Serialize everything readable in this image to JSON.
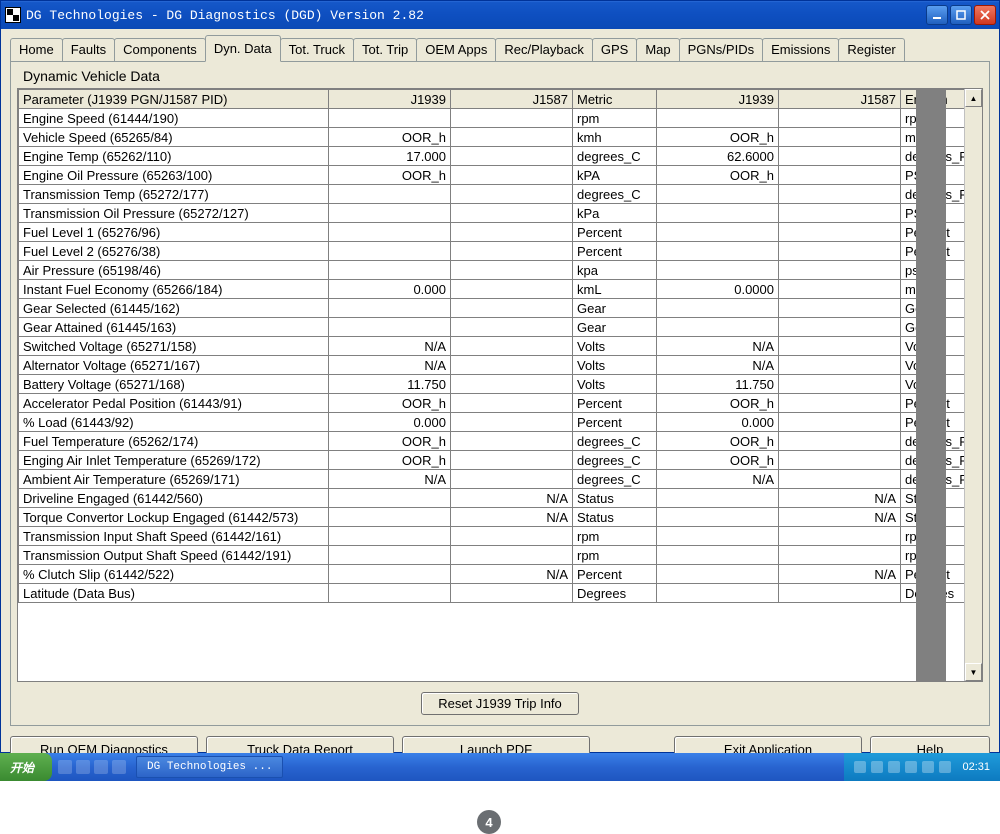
{
  "window": {
    "title": "DG Technologies - DG Diagnostics (DGD) Version 2.82"
  },
  "tabs": [
    "Home",
    "Faults",
    "Components",
    "Dyn. Data",
    "Tot. Truck",
    "Tot. Trip",
    "OEM Apps",
    "Rec/Playback",
    "GPS",
    "Map",
    "PGNs/PIDs",
    "Emissions",
    "Register"
  ],
  "active_tab": "Dyn. Data",
  "panel_title": "Dynamic Vehicle Data",
  "grid": {
    "headers": [
      "Parameter (J1939 PGN/J1587 PID)",
      "J1939",
      "J1587",
      "Metric",
      "J1939",
      "J1587",
      "English"
    ],
    "rows": [
      {
        "p": "Engine Speed (61444/190)",
        "a": "",
        "b": "",
        "m": "rpm",
        "c": "",
        "d": "",
        "e": "rpm"
      },
      {
        "p": "Vehicle Speed (65265/84)",
        "a": "OOR_h",
        "b": "",
        "m": "kmh",
        "c": "OOR_h",
        "d": "",
        "e": "mph"
      },
      {
        "p": "Engine Temp (65262/110)",
        "a": "17.000",
        "b": "",
        "m": "degrees_C",
        "c": "62.6000",
        "d": "",
        "e": "degrees_F"
      },
      {
        "p": "Engine Oil Pressure (65263/100)",
        "a": "OOR_h",
        "b": "",
        "m": "kPA",
        "c": "OOR_h",
        "d": "",
        "e": "PSI"
      },
      {
        "p": "Transmission Temp (65272/177)",
        "a": "",
        "b": "",
        "m": "degrees_C",
        "c": "",
        "d": "",
        "e": "degrees_F"
      },
      {
        "p": "Transmission Oil Pressure (65272/127)",
        "a": "",
        "b": "",
        "m": "kPa",
        "c": "",
        "d": "",
        "e": "PSI"
      },
      {
        "p": "Fuel Level 1 (65276/96)",
        "a": "",
        "b": "",
        "m": "Percent",
        "c": "",
        "d": "",
        "e": "Percent"
      },
      {
        "p": "Fuel Level 2 (65276/38)",
        "a": "",
        "b": "",
        "m": "Percent",
        "c": "",
        "d": "",
        "e": "Percent"
      },
      {
        "p": "Air Pressure (65198/46)",
        "a": "",
        "b": "",
        "m": "kpa",
        "c": "",
        "d": "",
        "e": "psi"
      },
      {
        "p": "Instant Fuel Economy (65266/184)",
        "a": "0.000",
        "b": "",
        "m": "kmL",
        "c": "0.0000",
        "d": "",
        "e": "mpg"
      },
      {
        "p": "Gear Selected (61445/162)",
        "a": "",
        "b": "",
        "m": "Gear",
        "c": "",
        "d": "",
        "e": "Gear"
      },
      {
        "p": "Gear Attained (61445/163)",
        "a": "",
        "b": "",
        "m": "Gear",
        "c": "",
        "d": "",
        "e": "Gear"
      },
      {
        "p": "Switched Voltage (65271/158)",
        "a": "N/A",
        "b": "",
        "m": "Volts",
        "c": "N/A",
        "d": "",
        "e": "Volts"
      },
      {
        "p": "Alternator Voltage (65271/167)",
        "a": "N/A",
        "b": "",
        "m": "Volts",
        "c": "N/A",
        "d": "",
        "e": "Volts"
      },
      {
        "p": "Battery Voltage (65271/168)",
        "a": "11.750",
        "b": "",
        "m": "Volts",
        "c": "11.750",
        "d": "",
        "e": "Volts"
      },
      {
        "p": "Accelerator Pedal Position (61443/91)",
        "a": "OOR_h",
        "b": "",
        "m": "Percent",
        "c": "OOR_h",
        "d": "",
        "e": "Percent"
      },
      {
        "p": "% Load (61443/92)",
        "a": "0.000",
        "b": "",
        "m": "Percent",
        "c": "0.000",
        "d": "",
        "e": "Percent"
      },
      {
        "p": "Fuel Temperature (65262/174)",
        "a": "OOR_h",
        "b": "",
        "m": "degrees_C",
        "c": "OOR_h",
        "d": "",
        "e": "degrees_F"
      },
      {
        "p": "Enging Air Inlet Temperature (65269/172)",
        "a": "OOR_h",
        "b": "",
        "m": "degrees_C",
        "c": "OOR_h",
        "d": "",
        "e": "degrees_F"
      },
      {
        "p": "Ambient Air Temperature (65269/171)",
        "a": "N/A",
        "b": "",
        "m": "degrees_C",
        "c": "N/A",
        "d": "",
        "e": "degrees_F"
      },
      {
        "p": "Driveline Engaged (61442/560)",
        "a": "",
        "b": "N/A",
        "m": "Status",
        "c": "",
        "d": "N/A",
        "e": "Status"
      },
      {
        "p": "Torque Convertor Lockup Engaged (61442/573)",
        "a": "",
        "b": "N/A",
        "m": "Status",
        "c": "",
        "d": "N/A",
        "e": "Status"
      },
      {
        "p": "Transmission Input Shaft Speed (61442/161)",
        "a": "",
        "b": "",
        "m": "rpm",
        "c": "",
        "d": "",
        "e": "rpm"
      },
      {
        "p": "Transmission Output Shaft Speed (61442/191)",
        "a": "",
        "b": "",
        "m": "rpm",
        "c": "",
        "d": "",
        "e": "rpm"
      },
      {
        "p": "% Clutch Slip (61442/522)",
        "a": "",
        "b": "N/A",
        "m": "Percent",
        "c": "",
        "d": "N/A",
        "e": "Percent"
      },
      {
        "p": "Latitude (Data Bus)",
        "a": "",
        "b": "",
        "m": "Degrees",
        "c": "",
        "d": "",
        "e": "Degrees"
      }
    ]
  },
  "buttons": {
    "reset": "Reset J1939 Trip Info",
    "run_oem": "Run OEM Diagnostics",
    "truck_report": "Truck Data Report",
    "launch_pdf": "Launch PDF",
    "exit": "Exit Application",
    "help": "Help"
  },
  "taskbar": {
    "start": "开始",
    "task_item": "DG Technologies ...",
    "clock": "02:31"
  },
  "badge": "4"
}
